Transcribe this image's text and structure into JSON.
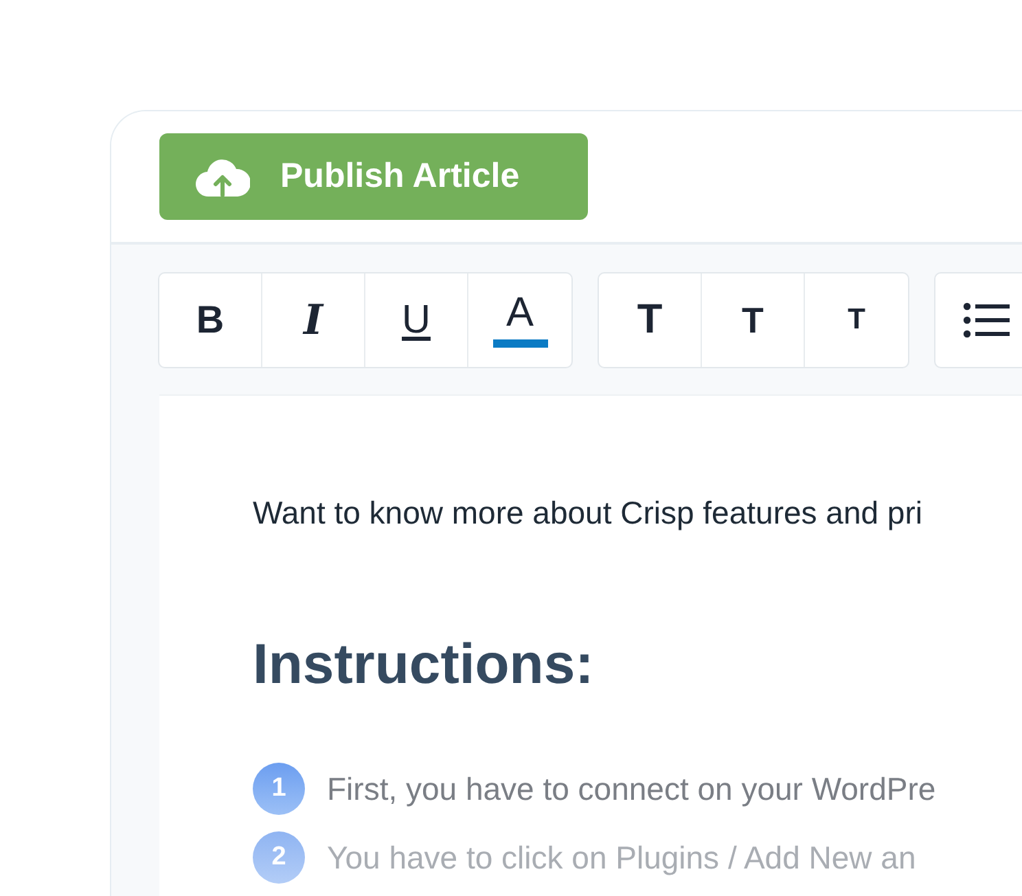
{
  "publish_button": {
    "label": "Publish Article"
  },
  "toolbar": {
    "groups": [
      {
        "buttons": [
          {
            "kind": "bold",
            "label": "B"
          },
          {
            "kind": "italic",
            "label": "I"
          },
          {
            "kind": "underline",
            "label": "U"
          },
          {
            "kind": "color",
            "label": "A",
            "color": "#0b7bc4"
          }
        ]
      },
      {
        "buttons": [
          {
            "kind": "size-large",
            "label": "T"
          },
          {
            "kind": "size-medium",
            "label": "T"
          },
          {
            "kind": "size-small",
            "label": "T"
          }
        ]
      },
      {
        "buttons": [
          {
            "kind": "list"
          }
        ]
      }
    ]
  },
  "editor": {
    "intro": "Want to know more about Crisp features and pri",
    "heading": "Instructions:",
    "steps": [
      {
        "number": "1",
        "text": "First, you have to connect on your WordPre",
        "dimmed": false
      },
      {
        "number": "2",
        "text": "You have to click on Plugins / Add New an",
        "dimmed": true
      }
    ]
  }
}
